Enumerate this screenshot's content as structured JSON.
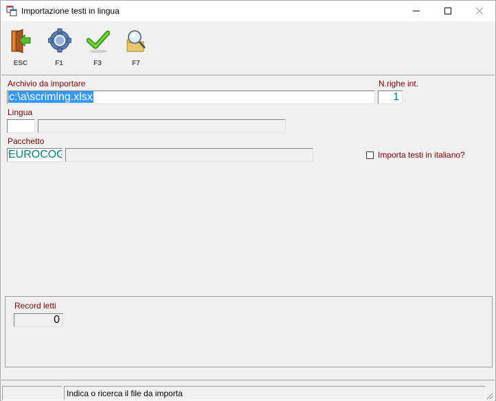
{
  "window": {
    "title": "Importazione testi in lingua"
  },
  "toolbar": {
    "buttons": [
      {
        "key": "ESC",
        "icon": "exit-door-icon"
      },
      {
        "key": "F1",
        "icon": "help-gear-icon"
      },
      {
        "key": "F3",
        "icon": "checkmark-icon"
      },
      {
        "key": "F7",
        "icon": "search-folder-icon"
      }
    ]
  },
  "form": {
    "archive_label": "Archivio da importare",
    "archive_value": "c:\\a\\scrimlng.xlsx",
    "rows_label": "N.righe int.",
    "rows_value": "1",
    "language_label": "Lingua",
    "language_code": "",
    "language_desc": "",
    "package_label": "Pacchetto",
    "package_code": "EUROCOGE",
    "package_desc": "",
    "import_italian_label": "Importa testi in italiano?",
    "import_italian_checked": false
  },
  "records": {
    "label": "Record letti",
    "value": "0"
  },
  "statusbar": {
    "cell1": "",
    "message": "Indica o ricerca il file da importa"
  },
  "colors": {
    "label_color": "#800000",
    "value_teal": "#008080",
    "selection": "#3399ff"
  }
}
